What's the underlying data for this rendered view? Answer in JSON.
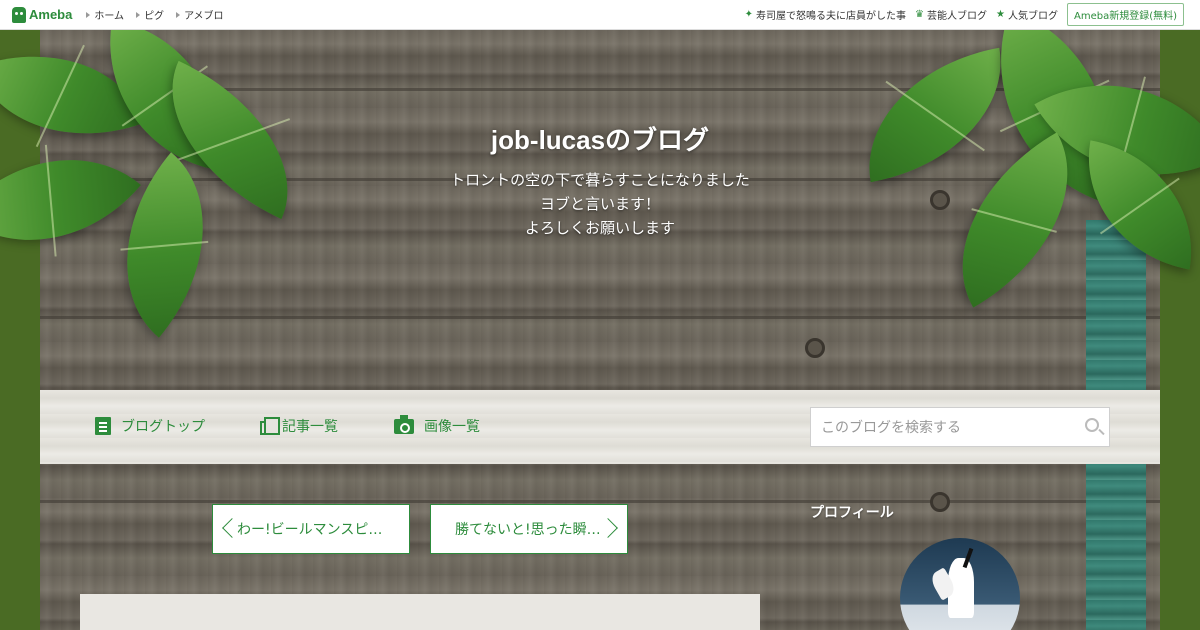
{
  "topbar": {
    "logo": "Ameba",
    "nav": [
      "ホーム",
      "ピグ",
      "アメブロ"
    ],
    "links": [
      {
        "icon": "sparkle-icon",
        "label": "寿司屋で怒鳴る夫に店員がした事"
      },
      {
        "icon": "crown-icon",
        "label": "芸能人ブログ"
      },
      {
        "icon": "crown-icon",
        "label": "人気ブログ"
      }
    ],
    "signup": "Ameba新規登録(無料)"
  },
  "header": {
    "title": "job-lucasのブログ",
    "description": [
      "トロントの空の下で暮らすことになりました",
      "ヨブと言います！",
      "よろしくお願いします"
    ]
  },
  "blognav": {
    "items": [
      {
        "icon": "document-icon",
        "label": "ブログトップ"
      },
      {
        "icon": "copy-icon",
        "label": "記事一覧"
      },
      {
        "icon": "camera-icon",
        "label": "画像一覧"
      }
    ],
    "search_placeholder": "このブログを検索する"
  },
  "pager": {
    "prev": "わー!ビールマンスピ…",
    "next": "勝てないと!思った瞬…"
  },
  "sidebar": {
    "profile_heading": "プロフィール"
  },
  "colors": {
    "accent": "#2d8c3c",
    "outer_bg": "#4a6b24"
  }
}
